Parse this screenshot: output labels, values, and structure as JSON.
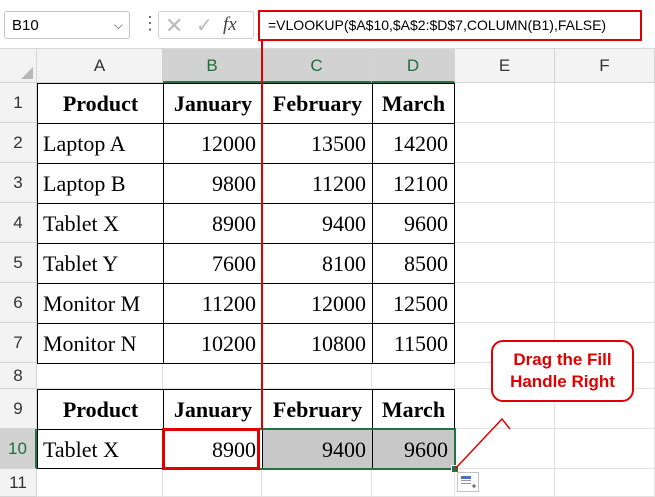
{
  "name_box": {
    "value": "B10"
  },
  "formula_bar": {
    "cancel_glyph": "✕",
    "enter_glyph": "✓",
    "fx_label": "fx",
    "formula": "=VLOOKUP($A$10,$A$2:$D$7,COLUMN(B1),FALSE)"
  },
  "columns": [
    "A",
    "B",
    "C",
    "D",
    "E",
    "F"
  ],
  "rows": [
    "1",
    "2",
    "3",
    "4",
    "5",
    "6",
    "7",
    "8",
    "9",
    "10",
    "11"
  ],
  "table1": {
    "headers": [
      "Product",
      "January",
      "February",
      "March"
    ],
    "data": [
      [
        "Laptop A",
        "12000",
        "13500",
        "14200"
      ],
      [
        "Laptop B",
        "9800",
        "11200",
        "12100"
      ],
      [
        "Tablet X",
        "8900",
        "9400",
        "9600"
      ],
      [
        "Tablet Y",
        "7600",
        "8100",
        "8500"
      ],
      [
        "Monitor M",
        "11200",
        "12000",
        "12500"
      ],
      [
        "Monitor N",
        "10200",
        "10800",
        "11500"
      ]
    ]
  },
  "table2": {
    "headers": [
      "Product",
      "January",
      "February",
      "March"
    ],
    "row": [
      "Tablet X",
      "8900",
      "9400",
      "9600"
    ]
  },
  "callout": {
    "line1": "Drag the Fill",
    "line2": "Handle Right"
  },
  "colors": {
    "accent_green": "#217346",
    "annotation_red": "#e00000",
    "selection_fill": "#c8c8c8"
  }
}
